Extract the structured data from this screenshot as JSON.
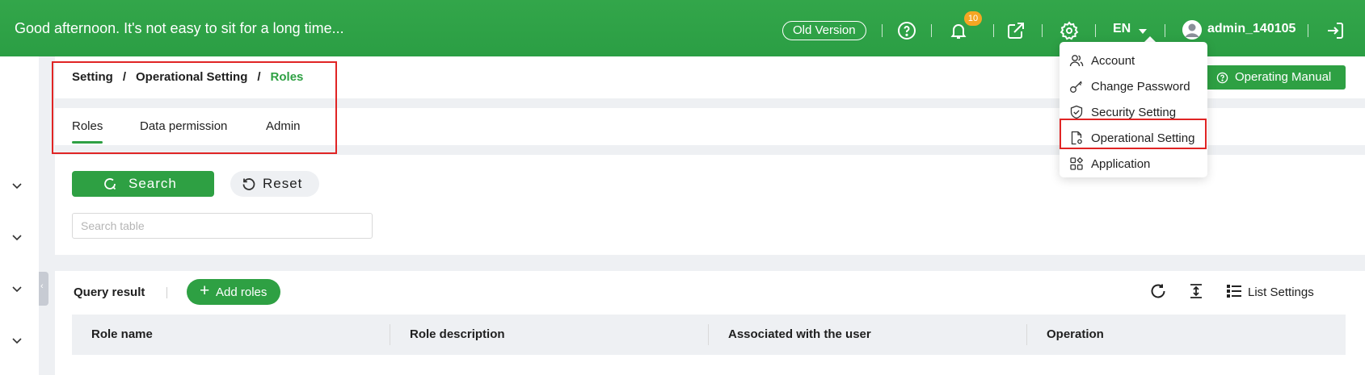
{
  "header": {
    "greeting": "Good afternoon. It's not easy to sit for a long time...",
    "old_version": "Old Version",
    "notification_count": "10",
    "language": "EN",
    "username": "admin_140105"
  },
  "user_menu": {
    "items": [
      {
        "label": "Account",
        "icon": "user-icon"
      },
      {
        "label": "Change Password",
        "icon": "key-icon"
      },
      {
        "label": "Security Setting",
        "icon": "shield-icon"
      },
      {
        "label": "Operational Setting",
        "icon": "file-gear-icon"
      },
      {
        "label": "Application",
        "icon": "apps-icon"
      }
    ]
  },
  "breadcrumb": {
    "items": [
      "Setting",
      "Operational Setting",
      "Roles"
    ]
  },
  "tabs": [
    "Roles",
    "Data permission",
    "Admin"
  ],
  "active_tab": "Roles",
  "operating_manual": "Operating Manual",
  "search": {
    "search_label": "Search",
    "reset_label": "Reset",
    "placeholder": "Search table"
  },
  "results": {
    "title": "Query result",
    "add_label": "Add roles",
    "list_settings": "List Settings",
    "columns": [
      "Role name",
      "Role description",
      "Associated with the user",
      "Operation"
    ]
  },
  "colors": {
    "brand_green": "#2ea043",
    "highlight_red": "#e02424",
    "badge_orange": "#f5a623"
  }
}
